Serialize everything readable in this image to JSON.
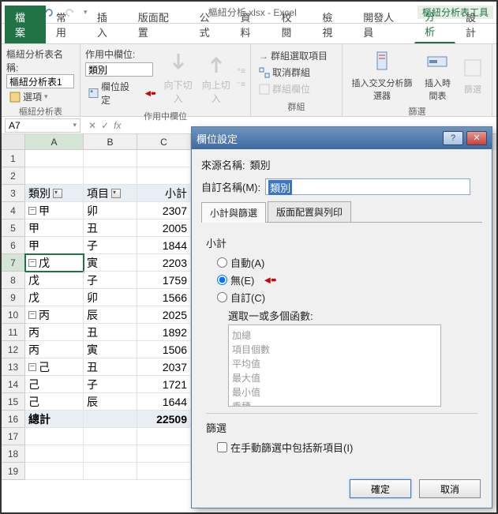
{
  "titlebar": {
    "title": "樞紐分析.xlsx - Excel",
    "right_label": "樞紐分析表工具"
  },
  "tabs": {
    "file": "檔案",
    "home": "常用",
    "insert": "插入",
    "layout": "版面配置",
    "formula": "公式",
    "data": "資料",
    "review": "校閱",
    "view": "檢視",
    "dev": "開發人員",
    "analyze": "分析",
    "design": "設計"
  },
  "ribbon": {
    "table_name_label": "樞紐分析表名稱:",
    "table_name": "樞紐分析表1",
    "options_btn": "選項",
    "group1_label": "樞紐分析表",
    "active_field_label": "作用中欄位:",
    "active_field": "類別",
    "field_settings_btn": "欄位設定",
    "group2_label": "作用中欄位",
    "drill_down": "向下切入",
    "drill_up": "向上切入",
    "group_select": "群組選取項目",
    "ungroup": "取消群組",
    "group_fields": "群組欄位",
    "group3_label": "群組",
    "insert_slicer": "插入交叉分析篩選器",
    "insert_timeline": "插入時間表",
    "filter_conn": "篩選",
    "group4_label": "篩選"
  },
  "namebox": "A7",
  "grid": {
    "cols": [
      "A",
      "B",
      "C"
    ],
    "header": {
      "a": "類別",
      "b": "項目",
      "c": "小計"
    },
    "rows": [
      {
        "n": 1,
        "a": "",
        "b": "",
        "c": ""
      },
      {
        "n": 2,
        "a": "",
        "b": "",
        "c": ""
      },
      {
        "n": 3,
        "a": "類別",
        "b": "項目",
        "c": "小計",
        "hdr": true
      },
      {
        "n": 4,
        "a": "甲",
        "b": "卯",
        "c": "2307",
        "exp": true
      },
      {
        "n": 5,
        "a": "甲",
        "b": "丑",
        "c": "2005"
      },
      {
        "n": 6,
        "a": "甲",
        "b": "子",
        "c": "1844"
      },
      {
        "n": 7,
        "a": "戊",
        "b": "寅",
        "c": "2203",
        "exp": true,
        "sel": true
      },
      {
        "n": 8,
        "a": "戊",
        "b": "子",
        "c": "1759"
      },
      {
        "n": 9,
        "a": "戊",
        "b": "卯",
        "c": "1566"
      },
      {
        "n": 10,
        "a": "丙",
        "b": "辰",
        "c": "2025",
        "exp": true
      },
      {
        "n": 11,
        "a": "丙",
        "b": "丑",
        "c": "1892"
      },
      {
        "n": 12,
        "a": "丙",
        "b": "寅",
        "c": "1506"
      },
      {
        "n": 13,
        "a": "己",
        "b": "丑",
        "c": "2037",
        "exp": true
      },
      {
        "n": 14,
        "a": "己",
        "b": "子",
        "c": "1721"
      },
      {
        "n": 15,
        "a": "己",
        "b": "辰",
        "c": "1644"
      },
      {
        "n": 16,
        "a": "總計",
        "b": "",
        "c": "22509",
        "total": true
      },
      {
        "n": 17,
        "a": "",
        "b": "",
        "c": ""
      },
      {
        "n": 18,
        "a": "",
        "b": "",
        "c": ""
      },
      {
        "n": 19,
        "a": "",
        "b": "",
        "c": ""
      }
    ]
  },
  "dialog": {
    "title": "欄位設定",
    "source_label": "來源名稱:",
    "source_value": "類別",
    "custom_label": "自訂名稱(M):",
    "custom_value": "類別",
    "tab1": "小計與篩選",
    "tab2": "版面配置與列印",
    "subtotal_label": "小計",
    "radio_auto": "自動(A)",
    "radio_none": "無(E)",
    "radio_custom": "自訂(C)",
    "funcs_label": "選取一或多個函數:",
    "funcs": [
      "加總",
      "項目個數",
      "平均值",
      "最大值",
      "最小值",
      "乘積"
    ],
    "filter_label": "篩選",
    "checkbox_label": "在手動篩選中包括新項目(I)",
    "ok": "確定",
    "cancel": "取消"
  }
}
